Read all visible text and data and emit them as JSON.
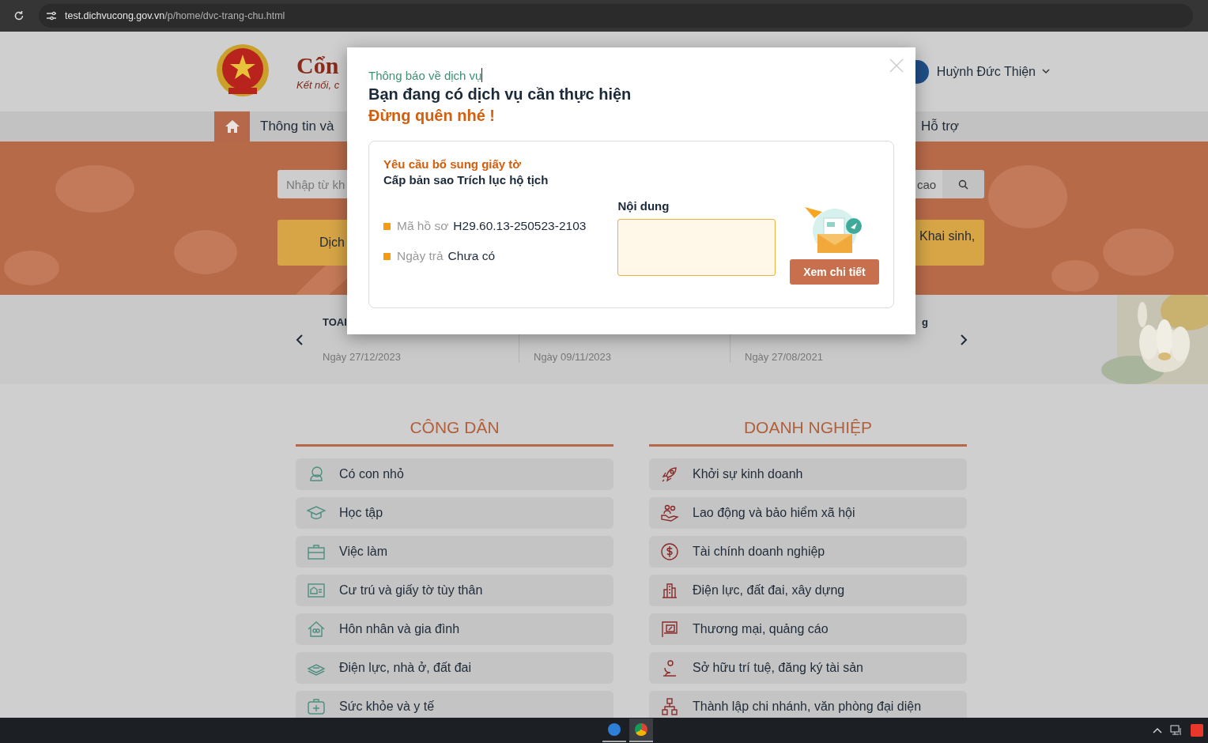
{
  "browser": {
    "url_host": "test.dichvucong.gov.vn",
    "url_path": "/p/home/dvc-trang-chu.html"
  },
  "header": {
    "logo_text": "Cổn",
    "tagline": "Kết nối, c",
    "user_name": "Huỳnh Đức Thiện"
  },
  "nav": [
    {
      "kind": "home",
      "selected": true
    },
    {
      "kind": "text",
      "label": "Thông tin và",
      "selected": false
    },
    {
      "kind": "text",
      "label": "Hỗ trợ",
      "selected": false
    }
  ],
  "search": {
    "placeholder": "Nhập từ kh",
    "advanced_label": "cao"
  },
  "quick_buttons": [
    "Dịch",
    "Khai sinh,"
  ],
  "news": [
    {
      "title": "TOAI",
      "kind": "start",
      "date": "Ngày 27/12/2023"
    },
    {
      "date": "Ngày 09/11/2023"
    },
    {
      "title": "g",
      "kind": "end",
      "date": "Ngày 27/08/2021"
    }
  ],
  "categories": [
    {
      "title": "CÔNG DÂN",
      "items": [
        "Có con nhỏ",
        "Học tập",
        "Việc làm",
        "Cư trú và giấy tờ tùy thân",
        "Hôn nhân và gia đình",
        "Điện lực, nhà ở, đất đai",
        "Sức khỏe và y tế"
      ]
    },
    {
      "title": "DOANH NGHIỆP",
      "items": [
        "Khởi sự kinh doanh",
        "Lao động và bảo hiểm xã hội",
        "Tài chính doanh nghiệp",
        "Điện lực, đất đai, xây dựng",
        "Thương mại, quảng cáo",
        "Sở hữu trí tuệ, đăng ký tài sản",
        "Thành lập chi nhánh, văn phòng đại diện"
      ]
    }
  ],
  "modal": {
    "subtitle": "Thông báo về dịch vụ",
    "title": "Bạn đang có dịch vụ cần thực hiện",
    "reminder": "Đừng quên nhé !",
    "card": {
      "status": "Yêu cầu bổ sung giấy tờ",
      "service": "Cấp bản sao Trích lục hộ tịch",
      "fields": [
        {
          "label": "Mã hồ sơ",
          "value": "H29.60.13-250523-2103"
        },
        {
          "label": "Ngày trả",
          "value": "Chưa có"
        }
      ],
      "content_label": "Nội dung",
      "button": "Xem chi tiết"
    }
  }
}
